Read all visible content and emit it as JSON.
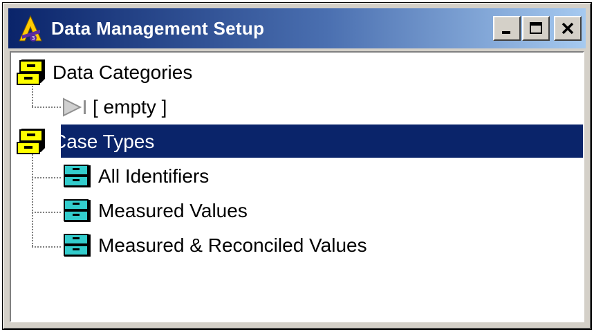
{
  "window": {
    "title": "Data Management Setup",
    "app_icon": "app-logo-icon",
    "buttons": {
      "minimize": "minimize-icon",
      "maximize": "maximize-icon",
      "close": "close-icon"
    }
  },
  "tree": {
    "groups": [
      {
        "label": "Data Categories",
        "icon": "yellow-drawer-icon",
        "children": [
          {
            "label": "[ empty ]",
            "icon": "play-to-end-icon"
          }
        ]
      },
      {
        "label": "Case Types",
        "icon": "yellow-drawer-icon",
        "selected": true,
        "children": [
          {
            "label": "All Identifiers",
            "icon": "cyan-drawer-icon"
          },
          {
            "label": "Measured Values",
            "icon": "cyan-drawer-icon"
          },
          {
            "label": "Measured & Reconciled Values",
            "icon": "cyan-drawer-icon"
          }
        ]
      }
    ]
  },
  "colors": {
    "titlebar_start": "#0a246a",
    "titlebar_end": "#a6caf0",
    "selection": "#0a246a",
    "window_face": "#d4d0c8",
    "folder_yellow": "#ffff00",
    "drawer_cyan": "#33cccc"
  }
}
